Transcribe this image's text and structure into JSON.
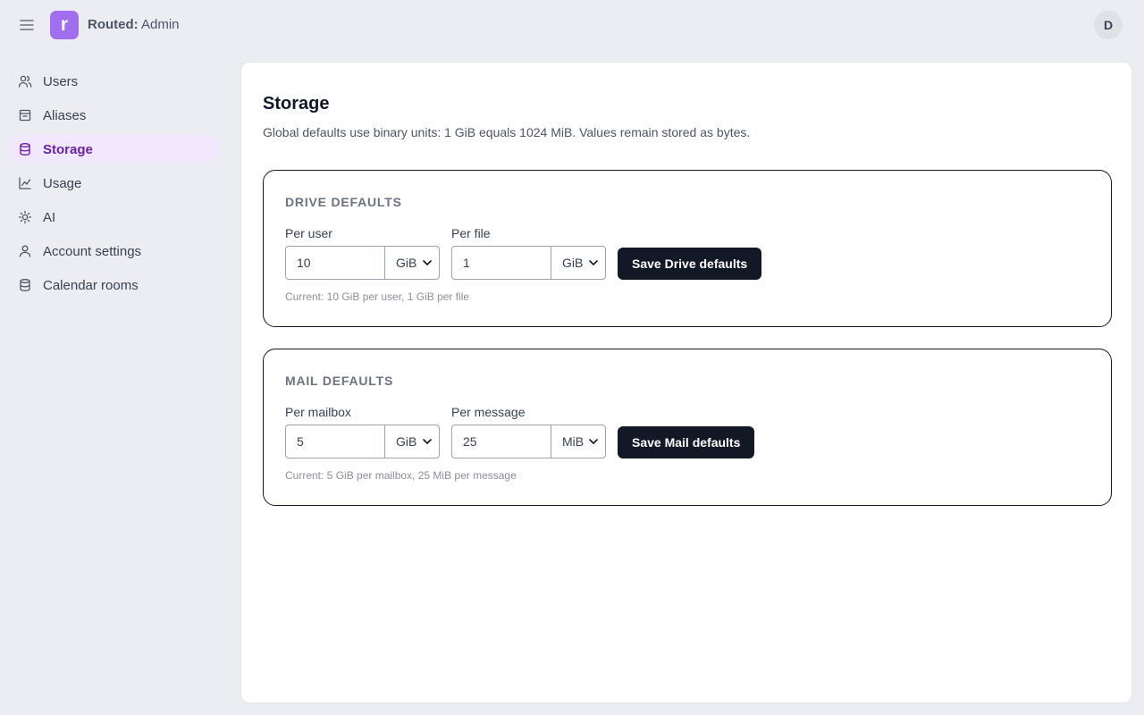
{
  "header": {
    "brand": "Routed:",
    "subtitle": " Admin",
    "logo_letter": "r",
    "avatar_initial": "D"
  },
  "sidebar": {
    "items": [
      {
        "label": "Users",
        "icon": "users-icon",
        "active": false
      },
      {
        "label": "Aliases",
        "icon": "inbox-icon",
        "active": false
      },
      {
        "label": "Storage",
        "icon": "database-icon",
        "active": true
      },
      {
        "label": "Usage",
        "icon": "chart-line-icon",
        "active": false
      },
      {
        "label": "AI",
        "icon": "sun-icon",
        "active": false
      },
      {
        "label": "Account settings",
        "icon": "user-icon",
        "active": false
      },
      {
        "label": "Calendar rooms",
        "icon": "database-icon",
        "active": false
      }
    ]
  },
  "page": {
    "title": "Storage",
    "description": "Global defaults use binary units: 1 GiB equals 1024 MiB. Values remain stored as bytes."
  },
  "drive": {
    "title": "DRIVE DEFAULTS",
    "per_user_label": "Per user",
    "per_user_value": "10",
    "per_user_unit": "GiB",
    "per_file_label": "Per file",
    "per_file_value": "1",
    "per_file_unit": "GiB",
    "save_label": "Save Drive defaults",
    "current": "Current: 10 GiB per user, 1 GiB per file"
  },
  "mail": {
    "title": "MAIL DEFAULTS",
    "per_mailbox_label": "Per mailbox",
    "per_mailbox_value": "5",
    "per_mailbox_unit": "GiB",
    "per_message_label": "Per message",
    "per_message_value": "25",
    "per_message_unit": "MiB",
    "save_label": "Save Mail defaults",
    "current": "Current: 5 GiB per mailbox, 25 MiB per message"
  },
  "colors": {
    "accent": "#a06ff0",
    "active_bg": "#f1e8fd",
    "active_text": "#6b21a8",
    "button_bg": "#121826"
  }
}
